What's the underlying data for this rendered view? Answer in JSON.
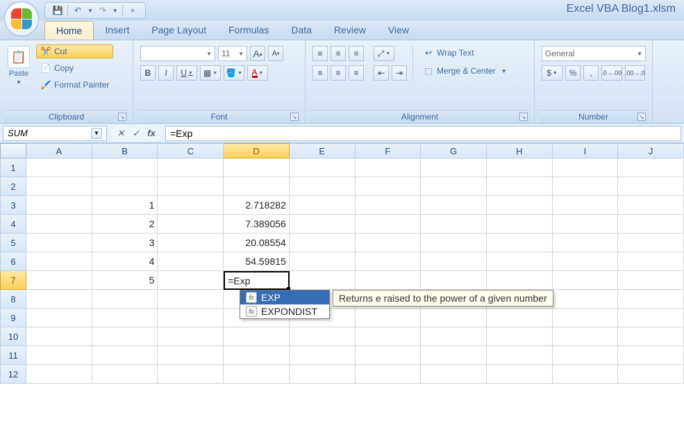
{
  "titlebar": {
    "title": "Excel VBA Blog1.xlsm"
  },
  "tabs": {
    "items": [
      "Home",
      "Insert",
      "Page Layout",
      "Formulas",
      "Data",
      "Review",
      "View"
    ],
    "active": 0
  },
  "ribbon": {
    "clipboard": {
      "title": "Clipboard",
      "paste": "Paste",
      "cut": "Cut",
      "copy": "Copy",
      "painter": "Format Painter"
    },
    "font": {
      "title": "Font",
      "size": "11",
      "bold": "B",
      "italic": "I",
      "underline": "U"
    },
    "alignment": {
      "title": "Alignment",
      "wrap": "Wrap Text",
      "merge": "Merge & Center"
    },
    "number": {
      "title": "Number",
      "format": "General"
    }
  },
  "formula_bar": {
    "namebox": "SUM",
    "formula": "=Exp"
  },
  "columns": [
    "A",
    "B",
    "C",
    "D",
    "E",
    "F",
    "G",
    "H",
    "I",
    "J"
  ],
  "rows": [
    "1",
    "2",
    "3",
    "4",
    "5",
    "6",
    "7",
    "8",
    "9",
    "10",
    "11",
    "12"
  ],
  "active_cell": {
    "col": "D",
    "row": "7",
    "text": "=Exp"
  },
  "cell_data": {
    "B": {
      "3": "1",
      "4": "2",
      "5": "3",
      "6": "4",
      "7": "5"
    },
    "D": {
      "3": "2.718282",
      "4": "7.389056",
      "5": "20.08554",
      "6": "54.59815"
    }
  },
  "autocomplete": {
    "items": [
      {
        "label": "EXP",
        "selected": true
      },
      {
        "label": "EXPONDIST",
        "selected": false
      }
    ],
    "tooltip": "Returns e raised to the power of a given number"
  }
}
